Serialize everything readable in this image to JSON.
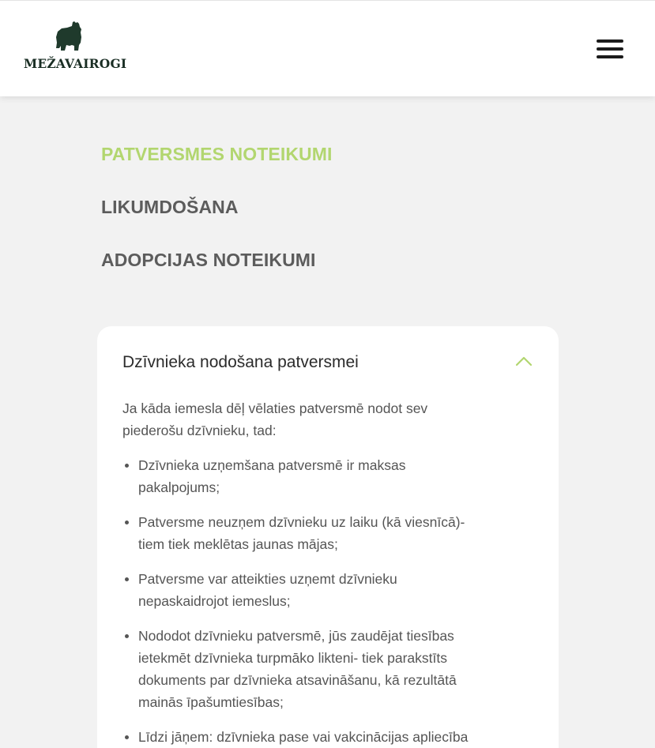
{
  "header": {
    "logo_text": "MEŽAVAIROGI",
    "logo_icon": "bear-icon",
    "menu_icon": "hamburger-menu-icon"
  },
  "nav": {
    "links": [
      {
        "label": "PATVERSMES NOTEIKUMI",
        "active": true
      },
      {
        "label": "LIKUMDOŠANA",
        "active": false
      },
      {
        "label": "ADOPCIJAS NOTEIKUMI",
        "active": false
      }
    ]
  },
  "accordion": {
    "title": "Dzīvnieka nodošana patversmei",
    "expanded": true,
    "intro": "Ja kāda iemesla dēļ vēlaties patversmē nodot sev piederošu dzīvnieku, tad:",
    "items": [
      "Dzīvnieka uzņemšana patversmē ir maksas pakalpojums;",
      "Patversme neuzņem dzīvnieku uz laiku (kā viesnīcā)- tiem tiek meklētas jaunas mājas;",
      "Patversme var atteikties uzņemt dzīvnieku nepaskaidrojot iemeslus;",
      "Nododot dzīvnieku patversmē, jūs zaudējat tiesības ietekmēt dzīvnieka turpmāko likteni- tiek parakstīts dokuments par dzīvnieka atsavināšanu, kā rezultātā mainās īpašumtiesības;",
      "Līdzi jāņem: dzīvnieka pase vai vakcinācijas apliecība"
    ]
  },
  "colors": {
    "accent": "#b2d66f",
    "nav_text": "#5c5c5c",
    "page_bg": "#f2f2f2",
    "logo": "#1f3a2c"
  }
}
